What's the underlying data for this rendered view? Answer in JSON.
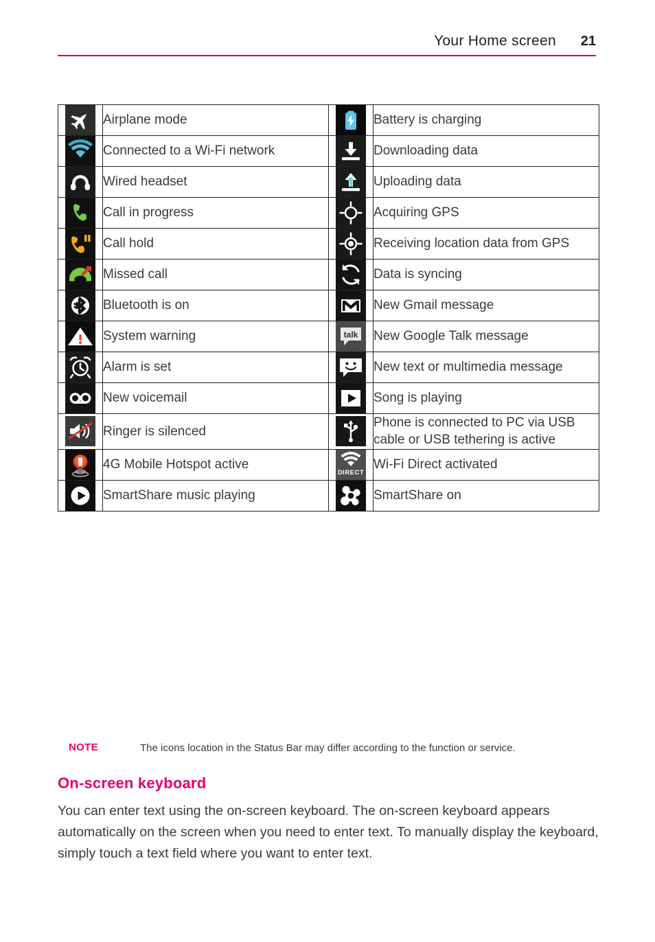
{
  "header": {
    "title": "Your Home screen",
    "page_number": "21",
    "rule_color": "#c4006b"
  },
  "icon_table": {
    "rows": [
      {
        "left": {
          "icon": "airplane-mode-icon",
          "label": "Airplane mode"
        },
        "right": {
          "icon": "battery-charging-icon",
          "label": "Battery is charging"
        }
      },
      {
        "left": {
          "icon": "wifi-connected-icon",
          "label": "Connected to a Wi-Fi network"
        },
        "right": {
          "icon": "download-data-icon",
          "label": "Downloading data"
        }
      },
      {
        "left": {
          "icon": "wired-headset-icon",
          "label": "Wired headset"
        },
        "right": {
          "icon": "upload-data-icon",
          "label": "Uploading data"
        }
      },
      {
        "left": {
          "icon": "call-in-progress-icon",
          "label": "Call in progress"
        },
        "right": {
          "icon": "acquiring-gps-icon",
          "label": "Acquiring GPS"
        }
      },
      {
        "left": {
          "icon": "call-hold-icon",
          "label": "Call hold"
        },
        "right": {
          "icon": "gps-location-icon",
          "label": "Receiving location data from GPS"
        }
      },
      {
        "left": {
          "icon": "missed-call-icon",
          "label": "Missed call"
        },
        "right": {
          "icon": "data-sync-icon",
          "label": "Data is syncing"
        }
      },
      {
        "left": {
          "icon": "bluetooth-icon",
          "label": "Bluetooth is on"
        },
        "right": {
          "icon": "gmail-icon",
          "label": "New Gmail message"
        }
      },
      {
        "left": {
          "icon": "system-warning-icon",
          "label": "System warning"
        },
        "right": {
          "icon": "google-talk-icon",
          "label": "New Google Talk message"
        }
      },
      {
        "left": {
          "icon": "alarm-set-icon",
          "label": "Alarm is set"
        },
        "right": {
          "icon": "new-message-icon",
          "label": "New text or multimedia message"
        }
      },
      {
        "left": {
          "icon": "voicemail-icon",
          "label": "New voicemail"
        },
        "right": {
          "icon": "music-playing-icon",
          "label": "Song is playing"
        }
      },
      {
        "left": {
          "icon": "ringer-silenced-icon",
          "label": "Ringer is silenced"
        },
        "right": {
          "icon": "usb-connected-icon",
          "label": "Phone is connected to PC via USB cable or USB tethering is active"
        }
      },
      {
        "left": {
          "icon": "mobile-hotspot-icon",
          "label": "4G Mobile Hotspot active"
        },
        "right": {
          "icon": "wifi-direct-icon",
          "label": "Wi-Fi Direct activated"
        }
      },
      {
        "left": {
          "icon": "smartshare-playing-icon",
          "label": "SmartShare music playing"
        },
        "right": {
          "icon": "smartshare-on-icon",
          "label": "SmartShare on"
        }
      }
    ]
  },
  "note": {
    "label": "NOTE",
    "text": "The icons location in the Status Bar may differ according to the function or service."
  },
  "section": {
    "heading": "On-screen keyboard",
    "paragraph": "You can enter text using the on-screen keyboard. The on-screen keyboard appears automatically on the screen when you need to enter text. To manually display the keyboard, simply touch a text field where you want to enter text.",
    "accent_color": "#e4006b"
  },
  "icon_glyphs": {
    "wifi_blue": "#4ec3e0",
    "battery_blue": "#5bc8e8",
    "call_green": "#7ac943",
    "hold_orange": "#f5a623",
    "missed_red": "#d93b26",
    "hotspot_orange": "#f2542d",
    "warning_red": "#e0322a"
  }
}
